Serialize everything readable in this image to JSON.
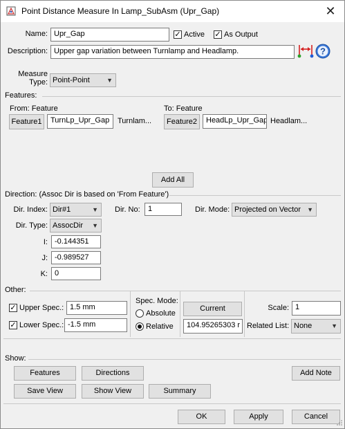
{
  "window": {
    "title": "Point Distance Measure In Lamp_SubAsm (Upr_Gap)"
  },
  "header": {
    "name_label": "Name:",
    "name_value": "Upr_Gap",
    "active_label": "Active",
    "as_output_label": "As Output",
    "description_label": "Description:",
    "description_value": "Upper gap variation between Turnlamp and Headlamp."
  },
  "measure": {
    "label_line1": "Measure",
    "label_line2": "Type:",
    "value": "Point-Point"
  },
  "features": {
    "section_label": "Features:",
    "from_label": "From: Feature",
    "from_button": "Feature1",
    "from_value": "TurnLp_Upr_Gap",
    "from_extra": "Turnlam...",
    "to_label": "To: Feature",
    "to_button": "Feature2",
    "to_value": "HeadLp_Upr_Gap",
    "to_extra": "Headlam...",
    "add_all": "Add All"
  },
  "direction": {
    "section_label": "Direction: (Assoc Dir is based on 'From Feature')",
    "index_label": "Dir. Index:",
    "index_value": "Dir#1",
    "no_label": "Dir. No:",
    "no_value": "1",
    "mode_label": "Dir. Mode:",
    "mode_value": "Projected on Vector",
    "type_label": "Dir. Type:",
    "type_value": "AssocDir",
    "i_label": "I:",
    "i_value": "-0.144351",
    "j_label": "J:",
    "j_value": "-0.989527",
    "k_label": "K:",
    "k_value": "0"
  },
  "other": {
    "section_label": "Other:",
    "upper_label": "Upper Spec.:",
    "upper_value": "1.5 mm",
    "lower_label": "Lower Spec.:",
    "lower_value": "-1.5 mm",
    "spec_mode_label": "Spec. Mode:",
    "absolute_label": "Absolute",
    "relative_label": "Relative",
    "current_button": "Current",
    "current_value": "104.95265303 r",
    "scale_label": "Scale:",
    "scale_value": "1",
    "related_label": "Related List:",
    "related_value": "None"
  },
  "show": {
    "section_label": "Show:",
    "features": "Features",
    "directions": "Directions",
    "add_note": "Add Note",
    "save_view": "Save View",
    "show_view": "Show View",
    "summary": "Summary"
  },
  "footer": {
    "ok": "OK",
    "apply": "Apply",
    "cancel": "Cancel"
  },
  "colors": {
    "dialog_bg": "#f0f0f0",
    "accent_red": "#d42020",
    "accent_blue": "#1e5bd6",
    "help_blue": "#3a78d8"
  }
}
